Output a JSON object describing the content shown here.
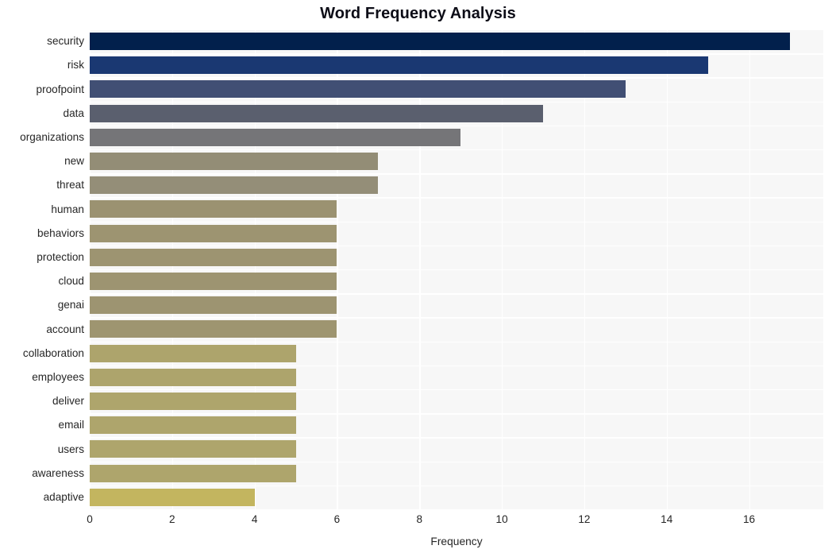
{
  "chart_data": {
    "type": "bar",
    "orientation": "horizontal",
    "title": "Word Frequency Analysis",
    "xlabel": "Frequency",
    "ylabel": "",
    "categories": [
      "security",
      "risk",
      "proofpoint",
      "data",
      "organizations",
      "new",
      "threat",
      "human",
      "behaviors",
      "protection",
      "cloud",
      "genai",
      "account",
      "collaboration",
      "employees",
      "deliver",
      "email",
      "users",
      "awareness",
      "adaptive"
    ],
    "values": [
      17,
      15,
      13,
      11,
      9,
      7,
      7,
      6,
      6,
      6,
      6,
      6,
      6,
      5,
      5,
      5,
      5,
      5,
      5,
      4
    ],
    "bar_colors": [
      "#02204c",
      "#1a3872",
      "#414f74",
      "#5a5f6e",
      "#757578",
      "#938d76",
      "#948e78",
      "#9b9271",
      "#9d9471",
      "#9d9471",
      "#9d9471",
      "#9d9471",
      "#9e9570",
      "#ada46c",
      "#ada46c",
      "#aea56c",
      "#aea56c",
      "#aea56c",
      "#aea56c",
      "#c3b55f"
    ],
    "xlim": [
      0,
      17.8
    ],
    "xticks": [
      0,
      2,
      4,
      6,
      8,
      10,
      12,
      14,
      16
    ],
    "xtick_labels": [
      "0",
      "2",
      "4",
      "6",
      "8",
      "10",
      "12",
      "14",
      "16"
    ],
    "grid": true,
    "grid_color": "#ffffff",
    "plot_background": "#f7f7f7",
    "figure_background": "#ffffff",
    "legend": null
  }
}
